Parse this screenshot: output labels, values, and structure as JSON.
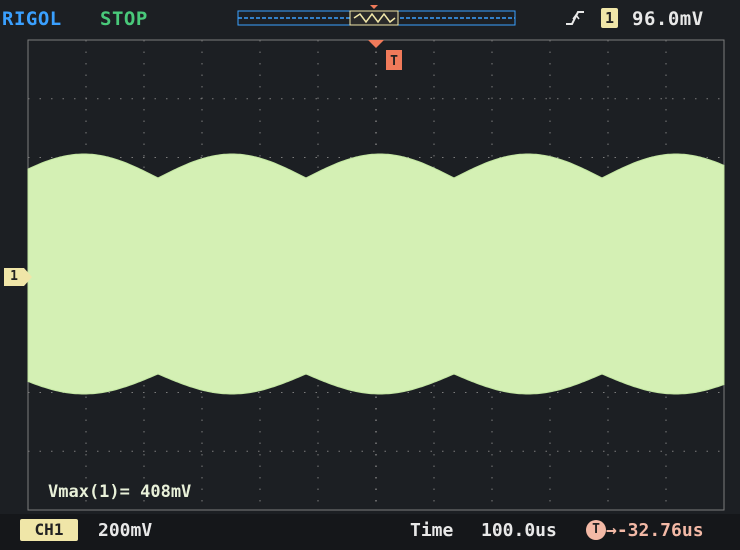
{
  "header": {
    "brand": "RIGOL",
    "run_state": "STOP",
    "trigger_edge_icon": "rising-edge-icon",
    "trigger_channel": "1",
    "trigger_level": "96.0mV",
    "trigger_marker_label": "T"
  },
  "channel": {
    "marker_label": "1"
  },
  "measurement": {
    "text": "Vmax(1)= 408mV"
  },
  "footer": {
    "ch1_label": "CH1",
    "ch1_scale": "200mV",
    "time_label": "Time",
    "time_value": "100.0us",
    "delay_icon_label": "T",
    "delay_value": "→-32.76us"
  },
  "colors": {
    "screen_bg": "#1c1f23",
    "grid": "#7c7c7c",
    "trace": "#d4f0b4",
    "brand": "#3aa0ff",
    "run_state": "#49c97a",
    "trigger": "#f07a5a"
  }
}
